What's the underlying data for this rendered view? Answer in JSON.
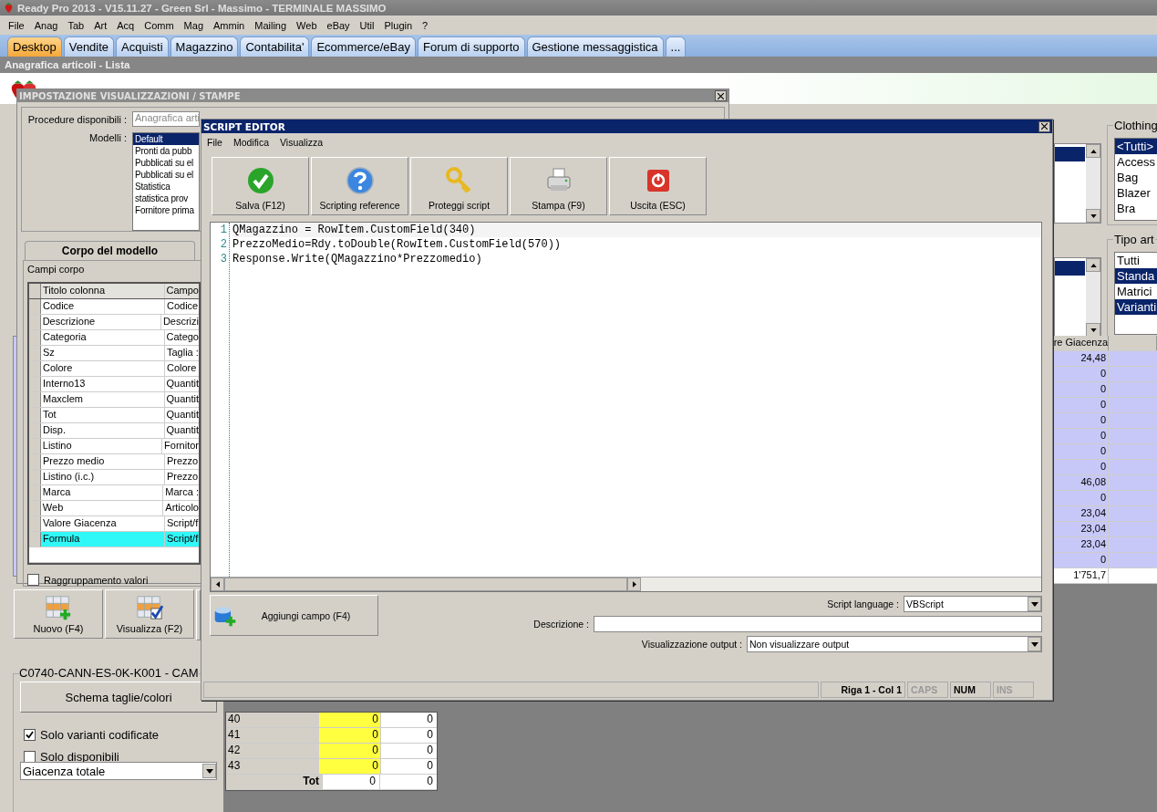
{
  "app_window": {
    "title": "Ready Pro 2013 - V15.11.27 - Green Srl - Massimo - TERMINALE MASSIMO"
  },
  "menu": [
    "File",
    "Anag",
    "Tab",
    "Art",
    "Acq",
    "Comm",
    "Mag",
    "Ammin",
    "Mailing",
    "Web",
    "eBay",
    "Util",
    "Plugin",
    "?"
  ],
  "tabs": [
    {
      "label": "Desktop",
      "selected": true
    },
    {
      "label": "Vendite",
      "selected": false
    },
    {
      "label": "Acquisti",
      "selected": false
    },
    {
      "label": "Magazzino",
      "selected": false
    },
    {
      "label": "Contabilita'",
      "selected": false
    },
    {
      "label": "Ecommerce/eBay",
      "selected": false
    },
    {
      "label": "Forum di supporto",
      "selected": false
    },
    {
      "label": "Gestione messaggistica",
      "selected": false
    },
    {
      "label": "...",
      "selected": false
    }
  ],
  "subtitle": "Anagrafica articoli  - Lista",
  "filters": [
    {
      "title": "Clothing",
      "items": [
        {
          "label": "<Tutti>",
          "selected": true
        },
        {
          "label": "Access",
          "selected": false
        },
        {
          "label": "Bag",
          "selected": false
        },
        {
          "label": "Blazer",
          "selected": false
        },
        {
          "label": "Bra",
          "selected": false
        }
      ]
    },
    {
      "title": "Tipo art",
      "items": [
        {
          "label": "Tutti",
          "selected": false
        },
        {
          "label": "Standa",
          "selected": true
        },
        {
          "label": "Matrici",
          "selected": false
        },
        {
          "label": "Varianti",
          "selected": true
        }
      ]
    }
  ],
  "grid": {
    "column": "re Giacenza",
    "rows": [
      "24,48",
      "0",
      "0",
      "0",
      "0",
      "0",
      "0",
      "0",
      "46,08",
      "0",
      "23,04",
      "23,04",
      "23,04",
      "0"
    ],
    "total": "1'751,7"
  },
  "main_buttons": [
    {
      "label": "Nuovo (F4)",
      "kind": "new"
    },
    {
      "label": "Visualizza (F2)",
      "kind": "view"
    }
  ],
  "variant_panel": {
    "title": "C0740-CANN-ES-0K-K001 - CAM",
    "button": "Schema taglie/colori",
    "checkboxes": [
      {
        "label": "Solo varianti codificate",
        "checked": true
      },
      {
        "label": "Solo disponibili",
        "checked": false
      }
    ],
    "select": "Giacenza totale",
    "size_rows": [
      {
        "size": "40",
        "column_2": "0",
        "column_3": "0"
      },
      {
        "size": "41",
        "column_2": "0",
        "column_3": "0"
      },
      {
        "size": "42",
        "column_2": "0",
        "column_3": "0"
      },
      {
        "size": "43",
        "column_2": "0",
        "column_3": "0"
      }
    ],
    "total": {
      "label": "Tot",
      "column_2": "0",
      "column_3": "0"
    }
  },
  "settings_dialog": {
    "title": "IMPOSTAZIONE VISUALIZZAZIONI / STAMPE",
    "procedure_label": "Procedure disponibili :",
    "procedure_value": "Anagrafica arti",
    "models_label": "Modelli :",
    "models": [
      {
        "label": "Default",
        "selected": true
      },
      {
        "label": "Pronti da pubb",
        "selected": false
      },
      {
        "label": "Pubblicati su el",
        "selected": false
      },
      {
        "label": "Pubblicati su el",
        "selected": false
      },
      {
        "label": "Statistica",
        "selected": false
      },
      {
        "label": "statistica prov",
        "selected": false
      },
      {
        "label": "Fornitore prima",
        "selected": false
      }
    ],
    "tab": "Corpo del modello",
    "fields_label": "Campi corpo",
    "columns": [
      "Titolo colonna",
      "Campo"
    ],
    "rows": [
      {
        "title": "Codice",
        "field": "Codice",
        "selected": false
      },
      {
        "title": "Descrizione",
        "field": "Descrizi",
        "selected": false
      },
      {
        "title": "Categoria",
        "field": "Catego",
        "selected": false
      },
      {
        "title": "Sz",
        "field": "Taglia :",
        "selected": false
      },
      {
        "title": "Colore",
        "field": "Colore",
        "selected": false
      },
      {
        "title": "Interno13",
        "field": "Quantit",
        "selected": false
      },
      {
        "title": "Maxclem",
        "field": "Quantit",
        "selected": false
      },
      {
        "title": "Tot",
        "field": "Quantit",
        "selected": false
      },
      {
        "title": "Disp.",
        "field": "Quantit",
        "selected": false
      },
      {
        "title": "Listino",
        "field": "Fornitor",
        "selected": false
      },
      {
        "title": "Prezzo medio",
        "field": "Prezzo",
        "selected": false
      },
      {
        "title": "Listino (i.c.)",
        "field": "Prezzo",
        "selected": false
      },
      {
        "title": "Marca",
        "field": "Marca :",
        "selected": false
      },
      {
        "title": "Web",
        "field": "Articolo",
        "selected": false
      },
      {
        "title": "Valore Giacenza",
        "field": "Script/f",
        "selected": false
      },
      {
        "title": "Formula",
        "field": "Script/f",
        "selected": true
      }
    ],
    "grouping": {
      "label": "Raggruppamento valori",
      "checked": false
    }
  },
  "script_editor": {
    "title": "SCRIPT EDITOR",
    "menu": [
      "File",
      "Modifica",
      "Visualizza"
    ],
    "toolbar": [
      {
        "label": "Salva (F12)",
        "kind": "save"
      },
      {
        "label": "Scripting reference",
        "kind": "help"
      },
      {
        "label": "Proteggi script",
        "kind": "protect"
      },
      {
        "label": "Stampa (F9)",
        "kind": "print"
      },
      {
        "label": "Uscita (ESC)",
        "kind": "exit"
      }
    ],
    "code_lines": [
      "QMagazzino = RowItem.CustomField(340)",
      "PrezzoMedio=Rdy.toDouble(RowItem.CustomField(570))",
      "Response.Write(QMagazzino*Prezzomedio)"
    ],
    "line_numbers": [
      "1",
      "2",
      "3"
    ],
    "add_field_button": "Aggiungi campo (F4)",
    "language_label": "Script language :",
    "language": "VBScript",
    "description_label": "Descrizione :",
    "output_label": "Visualizzazione output :",
    "output": "Non visualizzare output",
    "status": {
      "position": "Riga 1 - Col 1",
      "indicators": [
        {
          "label": "CAPS",
          "on": false
        },
        {
          "label": "NUM",
          "on": true
        },
        {
          "label": "INS",
          "on": false
        }
      ]
    }
  }
}
